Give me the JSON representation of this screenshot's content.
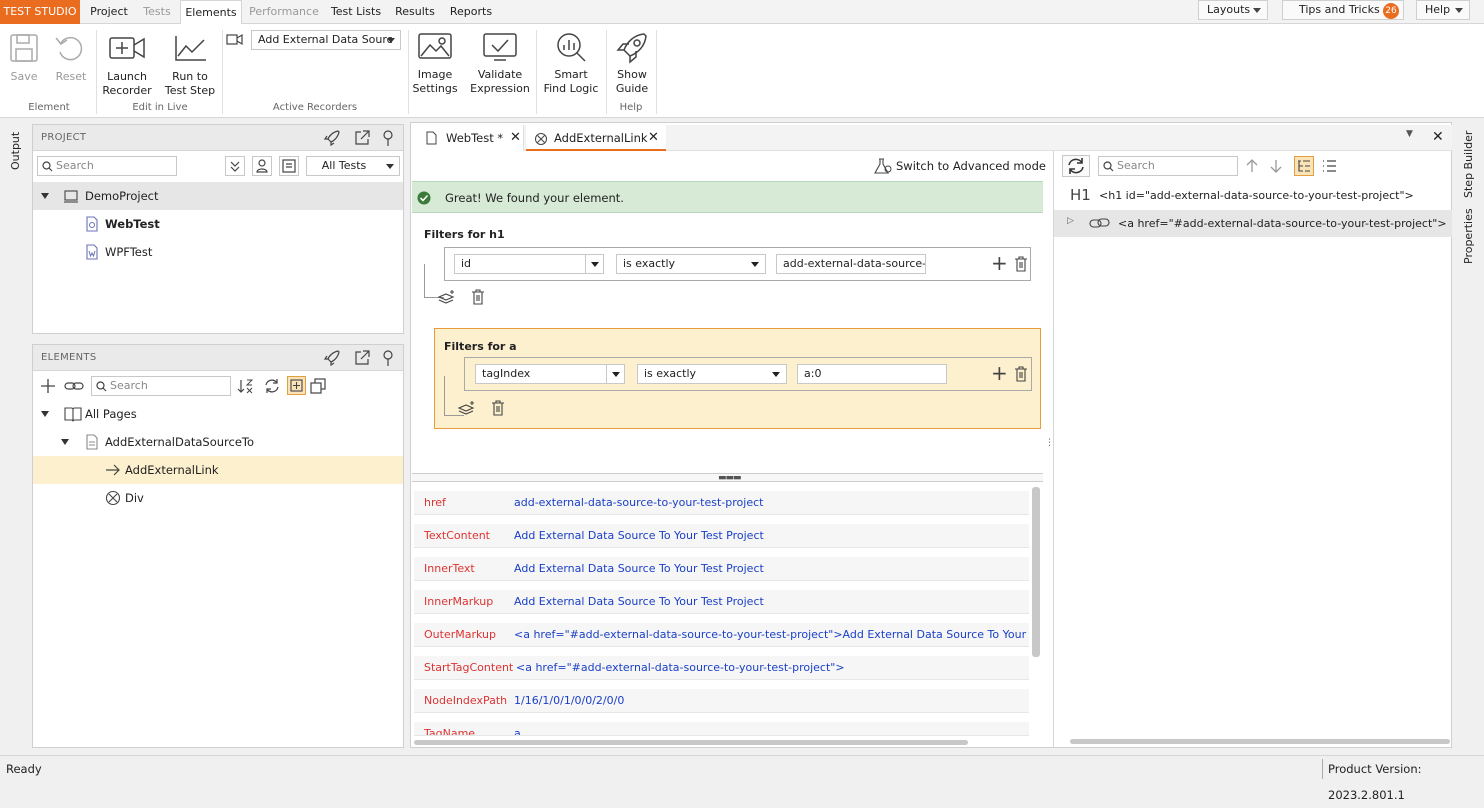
{
  "menubar": {
    "brand": "TEST STUDIO",
    "tabs": [
      {
        "label": "Project"
      },
      {
        "label": "Tests"
      },
      {
        "label": "Elements"
      },
      {
        "label": "Performance"
      },
      {
        "label": "Test Lists"
      },
      {
        "label": "Results"
      },
      {
        "label": "Reports"
      }
    ],
    "layouts": "Layouts",
    "tips": "Tips and Tricks",
    "tips_count": "26",
    "help": "Help"
  },
  "ribbon": {
    "save": "Save",
    "reset": "Reset",
    "group_element": "Element",
    "launch_recorder_1": "Launch",
    "launch_recorder_2": "Recorder",
    "run_to_1": "Run to",
    "run_to_2": "Test Step",
    "group_edit_live": "Edit in Live",
    "recorder_select": "Add External Data Sourc",
    "group_active_recorders": "Active Recorders",
    "image_settings_1": "Image",
    "image_settings_2": "Settings",
    "validate_1": "Validate",
    "validate_2": "Expression",
    "smart_1": "Smart",
    "smart_2": "Find Logic",
    "show_guide_1": "Show",
    "show_guide_2": "Guide",
    "group_help": "Help"
  },
  "side": {
    "output": "Output",
    "step_builder": "Step Builder",
    "properties": "Properties"
  },
  "project_panel": {
    "title": "PROJECT",
    "search_placeholder": "Search",
    "filter": "All Tests",
    "items": [
      {
        "label": "DemoProject"
      },
      {
        "label": "WebTest"
      },
      {
        "label": "WPFTest"
      }
    ]
  },
  "elements_panel": {
    "title": "ELEMENTS",
    "search_placeholder": "Search",
    "items": [
      {
        "label": "All Pages"
      },
      {
        "label": "AddExternalDataSourceTo"
      },
      {
        "label": "AddExternalLink"
      },
      {
        "label": "Div"
      }
    ]
  },
  "editor": {
    "tabs": [
      {
        "label": "WebTest *"
      },
      {
        "label": "AddExternalLink"
      }
    ],
    "advanced_mode": "Switch to Advanced mode",
    "found_message": "Great! We found your element.",
    "filters_h1": {
      "title": "Filters for h1",
      "attribute": "id",
      "operator": "is exactly",
      "value": "add-external-data-source-t"
    },
    "filters_a": {
      "title": "Filters for a",
      "attribute": "tagIndex",
      "operator": "is exactly",
      "value": "a:0"
    },
    "properties": [
      {
        "key": "href",
        "value": "add-external-data-source-to-your-test-project"
      },
      {
        "key": "TextContent",
        "value": "Add External Data Source To Your Test Project"
      },
      {
        "key": "InnerText",
        "value": "Add External Data Source To Your Test Project"
      },
      {
        "key": "InnerMarkup",
        "value": "Add External Data Source To Your Test Project"
      },
      {
        "key": "OuterMarkup",
        "value": "<a href=\"#add-external-data-source-to-your-test-project\">Add External Data Source To Your Test Pro"
      },
      {
        "key": "StartTagContent",
        "value": "<a href=\"#add-external-data-source-to-your-test-project\">"
      },
      {
        "key": "NodeIndexPath",
        "value": "1/16/1/0/1/0/0/2/0/0"
      },
      {
        "key": "TagName",
        "value": "a"
      }
    ]
  },
  "dom_panel": {
    "search_placeholder": "Search",
    "h1_tag": "H1",
    "h1_markup": "<h1 id=\"add-external-data-source-to-your-test-project\">",
    "a_markup": "<a href=\"#add-external-data-source-to-your-test-project\">"
  },
  "status": {
    "left": "Ready",
    "version": "Product Version: 2023.2.801.1"
  }
}
